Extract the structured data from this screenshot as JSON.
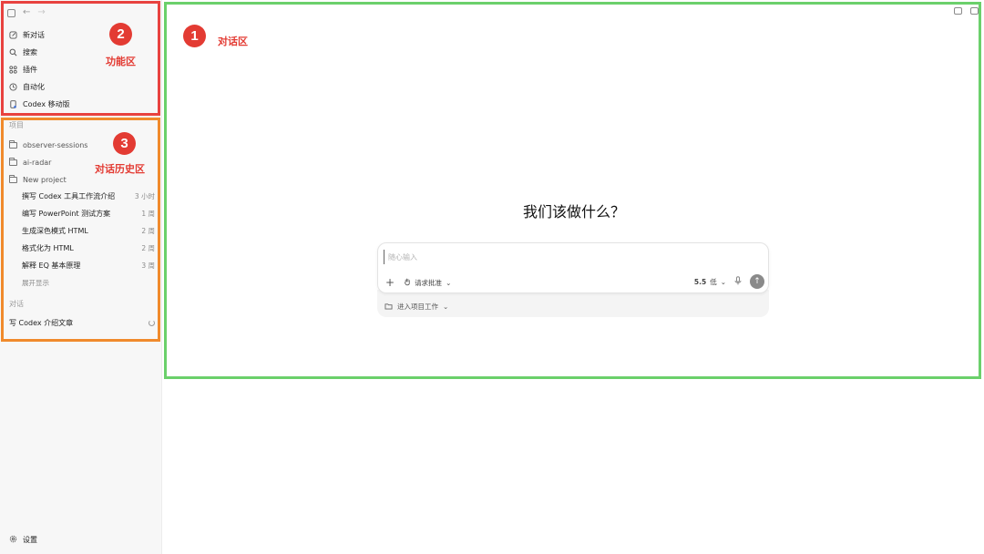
{
  "sidebar": {
    "nav_back": "←",
    "nav_forward": "→",
    "menu": [
      {
        "label": "新对话",
        "icon": "edit-icon"
      },
      {
        "label": "搜索",
        "icon": "search-icon"
      },
      {
        "label": "插件",
        "icon": "plugin-icon"
      },
      {
        "label": "自动化",
        "icon": "clock-icon"
      },
      {
        "label": "Codex 移动版",
        "icon": "mobile-icon"
      }
    ],
    "projects_label": "项目",
    "folders": [
      "observer-sessions",
      "ai-radar",
      "New project"
    ],
    "threads": [
      {
        "title": "撰写 Codex 工具工作流介绍",
        "time": "3 小时"
      },
      {
        "title": "编写 PowerPoint 测试方案",
        "time": "1 周"
      },
      {
        "title": "生成深色模式 HTML",
        "time": "2 周"
      },
      {
        "title": "格式化为 HTML",
        "time": "2 周"
      },
      {
        "title": "解释 EQ 基本原理",
        "time": "3 周"
      }
    ],
    "expand_label": "展开显示",
    "chats_label": "对话",
    "chats": [
      {
        "title": "写 Codex 介绍文章"
      }
    ],
    "settings_label": "设置"
  },
  "main": {
    "headline": "我们该做什么？",
    "composer": {
      "placeholder": "随心输入",
      "approval_label": "请求批准",
      "model_label": "5.5",
      "effort_label": "低",
      "send_icon": "↑"
    },
    "subbar_label": "进入项目工作"
  },
  "annotations": {
    "badge1": "1",
    "label1": "对话区",
    "badge2": "2",
    "label2": "功能区",
    "badge3": "3",
    "label3": "对话历史区",
    "colors": {
      "red": "#e8423f",
      "orange": "#f08a2c",
      "green": "#6bd06b"
    }
  }
}
